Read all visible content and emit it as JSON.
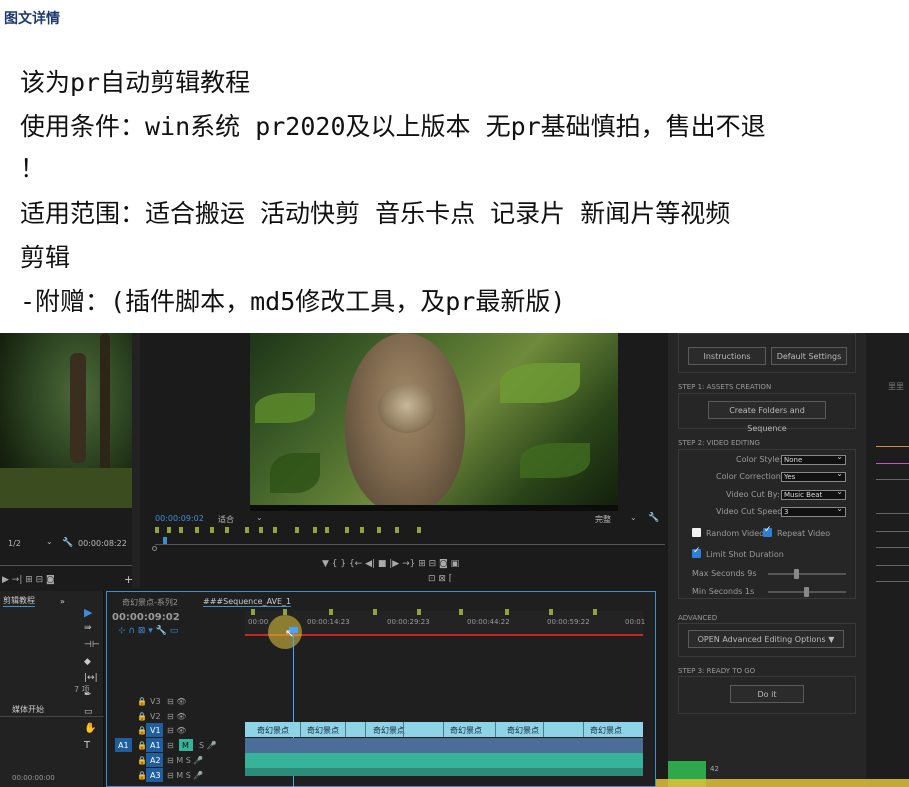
{
  "header": {
    "title": "图文详情"
  },
  "description": {
    "lines": [
      "该为pr自动剪辑教程",
      "使用条件：win系统   pr2020及以上版本  无pr基础慎拍，售出不退",
      "！",
      "适用范围：适合搬运  活动快剪  音乐卡点  记录片 新闻片等视频",
      "剪辑",
      "-附赠：(插件脚本，md5修改工具，及pr最新版)"
    ]
  },
  "source_monitor": {
    "zoom": "1/2",
    "timecode": "00:00:08:22"
  },
  "program_monitor": {
    "timecode": "00:00:09:02",
    "fit": "适合",
    "quality": "完整"
  },
  "project_panel": {
    "title": "剪辑教程",
    "count": "7 项",
    "item": "媒体开始",
    "timecode": "00:00:00:00"
  },
  "timeline": {
    "tabs": [
      "奇幻景点-系列2",
      "###Sequence_AVE_1"
    ],
    "timecode": "00:00:09:02",
    "ruler": [
      "00:00",
      "00:00:14:23",
      "00:00:29:23",
      "00:00:44:22",
      "00:00:59:22",
      "00:01"
    ],
    "tracks": [
      "V3",
      "V2",
      "V1",
      "A1",
      "A2",
      "A3"
    ],
    "clip_label": "奇幻景点"
  },
  "plugin": {
    "instructions": "Instructions",
    "default_settings": "Default Settings",
    "step1": "STEP 1: ASSETS CREATION",
    "create_folders": "Create Folders and Sequence",
    "step2": "STEP 2: VIDEO EDITING",
    "color_style_label": "Color Style:",
    "color_style_value": "None",
    "color_correction_label": "Color Correction:",
    "color_correction_value": "Yes",
    "video_cut_by_label": "Video Cut By:",
    "video_cut_by_value": "Music Beat",
    "video_cut_speed_label": "Video Cut Speed:",
    "video_cut_speed_value": "3",
    "random_video": "Random Video",
    "repeat_video": "Repeat Video",
    "limit_shot": "Limit Shot Duration",
    "max_seconds": "Max Seconds 9s",
    "min_seconds": "Min Seconds 1s",
    "advanced": "ADVANCED",
    "open_advanced": "OPEN Advanced Editing Options",
    "step3": "STEP 3: READY TO GO",
    "do_it": "Do it"
  },
  "right_panel": {
    "label": "里里",
    "number": "42"
  },
  "colors": {
    "accent": "#3b8ed8",
    "clip_teal": "#37b39a",
    "clip_light": "#8fd3e6",
    "playhead": "#4aa3ff"
  }
}
